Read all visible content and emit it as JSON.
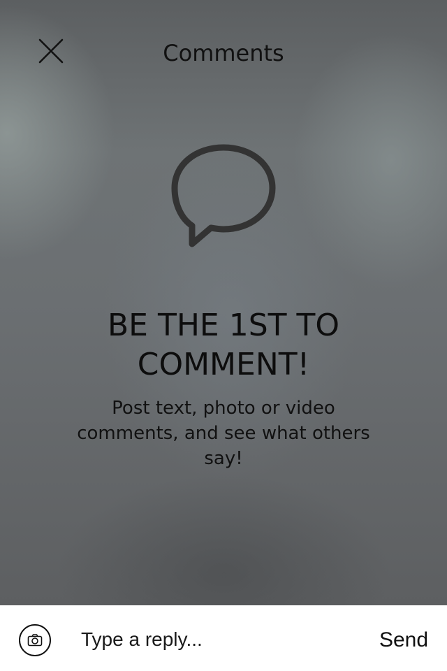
{
  "header": {
    "title": "Comments",
    "close_icon": "close-icon"
  },
  "empty_state": {
    "icon": "speech-bubble-icon",
    "headline": "BE THE 1ST TO COMMENT!",
    "message": "Post text, photo or video comments, and see what others say!"
  },
  "reply_bar": {
    "camera_icon": "camera-icon",
    "placeholder": "Type a reply...",
    "send_label": "Send"
  },
  "colors": {
    "text": "#111111",
    "bar_background": "#ffffff",
    "icon_stroke": "#333333"
  }
}
